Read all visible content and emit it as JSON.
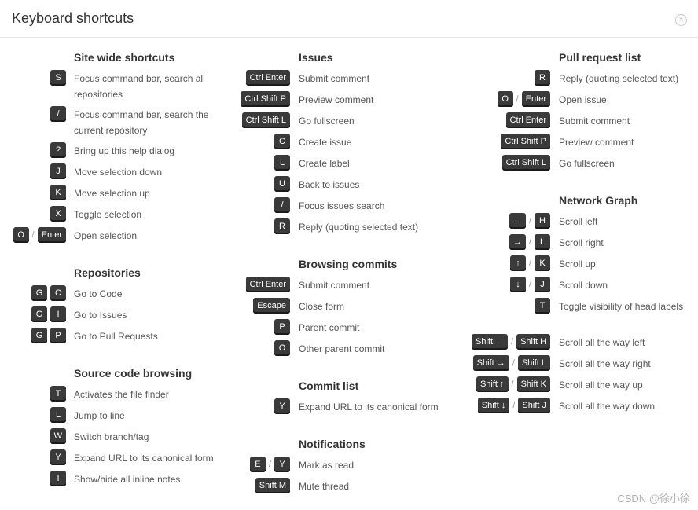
{
  "dialog": {
    "title": "Keyboard shortcuts",
    "close_glyph": "×"
  },
  "sections": {
    "site_wide": {
      "title": "Site wide shortcuts",
      "rows": [
        {
          "keys": [
            "S"
          ],
          "desc": "Focus command bar, search all repositories"
        },
        {
          "keys": [
            "/"
          ],
          "desc": "Focus command bar, search the current repository"
        },
        {
          "keys": [
            "?"
          ],
          "desc": "Bring up this help dialog"
        },
        {
          "keys": [
            "J"
          ],
          "desc": "Move selection down"
        },
        {
          "keys": [
            "K"
          ],
          "desc": "Move selection up"
        },
        {
          "keys": [
            "X"
          ],
          "desc": "Toggle selection"
        },
        {
          "keys": [
            "O",
            "Enter"
          ],
          "sep": "/",
          "desc": "Open selection"
        }
      ]
    },
    "repositories": {
      "title": "Repositories",
      "rows": [
        {
          "keys": [
            "G",
            "C"
          ],
          "desc": "Go to Code"
        },
        {
          "keys": [
            "G",
            "I"
          ],
          "desc": "Go to Issues"
        },
        {
          "keys": [
            "G",
            "P"
          ],
          "desc": "Go to Pull Requests"
        }
      ]
    },
    "source_code": {
      "title": "Source code browsing",
      "rows": [
        {
          "keys": [
            "T"
          ],
          "desc": "Activates the file finder"
        },
        {
          "keys": [
            "L"
          ],
          "desc": "Jump to line"
        },
        {
          "keys": [
            "W"
          ],
          "desc": "Switch branch/tag"
        },
        {
          "keys": [
            "Y"
          ],
          "desc": "Expand URL to its canonical form"
        },
        {
          "keys": [
            "I"
          ],
          "desc": "Show/hide all inline notes"
        }
      ]
    },
    "issues": {
      "title": "Issues",
      "rows": [
        {
          "keys": [
            "Ctrl Enter"
          ],
          "desc": "Submit comment"
        },
        {
          "keys": [
            "Ctrl Shift P"
          ],
          "desc": "Preview comment"
        },
        {
          "keys": [
            "Ctrl Shift L"
          ],
          "desc": "Go fullscreen"
        },
        {
          "keys": [
            "C"
          ],
          "desc": "Create issue"
        },
        {
          "keys": [
            "L"
          ],
          "desc": "Create label"
        },
        {
          "keys": [
            "U"
          ],
          "desc": "Back to issues"
        },
        {
          "keys": [
            "/"
          ],
          "desc": "Focus issues search"
        },
        {
          "keys": [
            "R"
          ],
          "desc": "Reply (quoting selected text)"
        }
      ]
    },
    "browsing_commits": {
      "title": "Browsing commits",
      "rows": [
        {
          "keys": [
            "Ctrl Enter"
          ],
          "desc": "Submit comment"
        },
        {
          "keys": [
            "Escape"
          ],
          "desc": "Close form"
        },
        {
          "keys": [
            "P"
          ],
          "desc": "Parent commit"
        },
        {
          "keys": [
            "O"
          ],
          "desc": "Other parent commit"
        }
      ]
    },
    "commit_list": {
      "title": "Commit list",
      "rows": [
        {
          "keys": [
            "Y"
          ],
          "desc": "Expand URL to its canonical form"
        }
      ]
    },
    "notifications": {
      "title": "Notifications",
      "rows": [
        {
          "keys": [
            "E",
            "Y"
          ],
          "sep": "/",
          "desc": "Mark as read"
        },
        {
          "keys": [
            "Shift M"
          ],
          "desc": "Mute thread"
        }
      ]
    },
    "pull_request_list": {
      "title": "Pull request list",
      "rows": [
        {
          "keys": [
            "R"
          ],
          "desc": "Reply (quoting selected text)"
        },
        {
          "keys": [
            "O",
            "Enter"
          ],
          "sep": "/",
          "desc": "Open issue"
        },
        {
          "keys": [
            "Ctrl Enter"
          ],
          "desc": "Submit comment"
        },
        {
          "keys": [
            "Ctrl Shift P"
          ],
          "desc": "Preview comment"
        },
        {
          "keys": [
            "Ctrl Shift L"
          ],
          "desc": "Go fullscreen"
        }
      ]
    },
    "network_graph": {
      "title": "Network Graph",
      "rows": [
        {
          "keys": [
            "←",
            "H"
          ],
          "sep": "/",
          "desc": "Scroll left"
        },
        {
          "keys": [
            "→",
            "L"
          ],
          "sep": "/",
          "desc": "Scroll right"
        },
        {
          "keys": [
            "↑",
            "K"
          ],
          "sep": "/",
          "desc": "Scroll up"
        },
        {
          "keys": [
            "↓",
            "J"
          ],
          "sep": "/",
          "desc": "Scroll down"
        },
        {
          "keys": [
            "T"
          ],
          "desc": "Toggle visibility of head labels"
        },
        {
          "keys": [
            "Shift ←",
            "Shift H"
          ],
          "sep": "/",
          "desc": "Scroll all the way left"
        },
        {
          "keys": [
            "Shift →",
            "Shift L"
          ],
          "sep": "/",
          "desc": "Scroll all the way right"
        },
        {
          "keys": [
            "Shift ↑",
            "Shift K"
          ],
          "sep": "/",
          "desc": "Scroll all the way up"
        },
        {
          "keys": [
            "Shift ↓",
            "Shift J"
          ],
          "sep": "/",
          "desc": "Scroll all the way down"
        }
      ]
    }
  },
  "watermark": "CSDN @徐小徐"
}
